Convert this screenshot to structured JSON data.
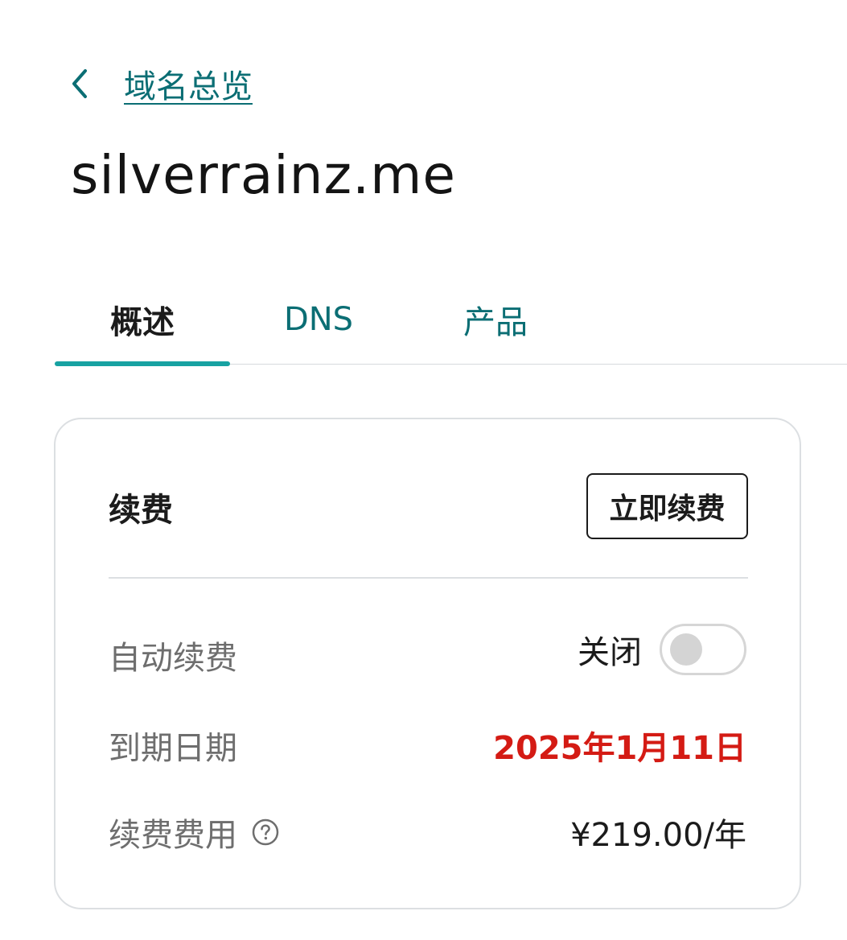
{
  "header": {
    "back_label": "域名总览",
    "domain": "silverrainz.me"
  },
  "tabs": [
    {
      "label": "概述",
      "active": true
    },
    {
      "label": "DNS",
      "active": false
    },
    {
      "label": "产品",
      "active": false
    }
  ],
  "renewal": {
    "title": "续费",
    "renew_now_label": "立即续费",
    "auto_renew": {
      "label": "自动续费",
      "state_text": "关闭",
      "enabled": false
    },
    "expiry": {
      "label": "到期日期",
      "value": "2025年1月11日"
    },
    "fee": {
      "label": "续费费用",
      "value": "¥219.00/年",
      "help_icon": "question-circle-icon"
    }
  },
  "colors": {
    "link": "#0b6e74",
    "tab_indicator": "#17a2a2",
    "expiry_red": "#d41b14",
    "text": "#1b1b1b",
    "muted": "#6e6e6e"
  }
}
